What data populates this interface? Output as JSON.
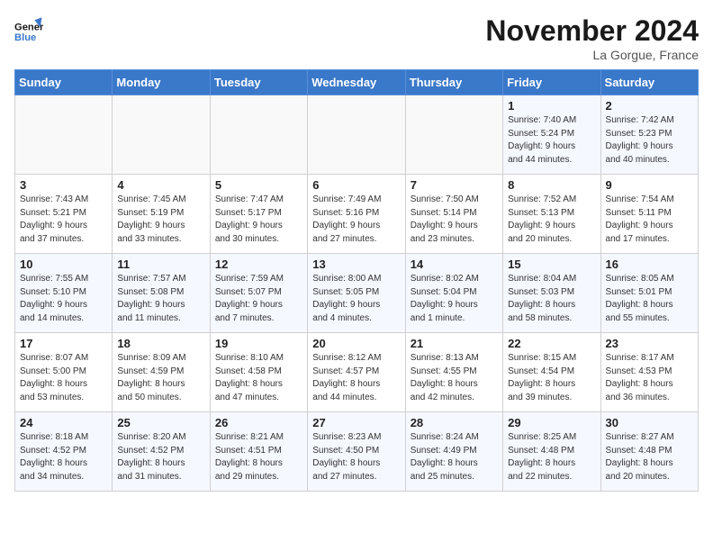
{
  "header": {
    "logo_line1": "General",
    "logo_line2": "Blue",
    "month": "November 2024",
    "location": "La Gorgue, France"
  },
  "weekdays": [
    "Sunday",
    "Monday",
    "Tuesday",
    "Wednesday",
    "Thursday",
    "Friday",
    "Saturday"
  ],
  "weeks": [
    [
      {
        "day": "",
        "info": ""
      },
      {
        "day": "",
        "info": ""
      },
      {
        "day": "",
        "info": ""
      },
      {
        "day": "",
        "info": ""
      },
      {
        "day": "",
        "info": ""
      },
      {
        "day": "1",
        "info": "Sunrise: 7:40 AM\nSunset: 5:24 PM\nDaylight: 9 hours\nand 44 minutes."
      },
      {
        "day": "2",
        "info": "Sunrise: 7:42 AM\nSunset: 5:23 PM\nDaylight: 9 hours\nand 40 minutes."
      }
    ],
    [
      {
        "day": "3",
        "info": "Sunrise: 7:43 AM\nSunset: 5:21 PM\nDaylight: 9 hours\nand 37 minutes."
      },
      {
        "day": "4",
        "info": "Sunrise: 7:45 AM\nSunset: 5:19 PM\nDaylight: 9 hours\nand 33 minutes."
      },
      {
        "day": "5",
        "info": "Sunrise: 7:47 AM\nSunset: 5:17 PM\nDaylight: 9 hours\nand 30 minutes."
      },
      {
        "day": "6",
        "info": "Sunrise: 7:49 AM\nSunset: 5:16 PM\nDaylight: 9 hours\nand 27 minutes."
      },
      {
        "day": "7",
        "info": "Sunrise: 7:50 AM\nSunset: 5:14 PM\nDaylight: 9 hours\nand 23 minutes."
      },
      {
        "day": "8",
        "info": "Sunrise: 7:52 AM\nSunset: 5:13 PM\nDaylight: 9 hours\nand 20 minutes."
      },
      {
        "day": "9",
        "info": "Sunrise: 7:54 AM\nSunset: 5:11 PM\nDaylight: 9 hours\nand 17 minutes."
      }
    ],
    [
      {
        "day": "10",
        "info": "Sunrise: 7:55 AM\nSunset: 5:10 PM\nDaylight: 9 hours\nand 14 minutes."
      },
      {
        "day": "11",
        "info": "Sunrise: 7:57 AM\nSunset: 5:08 PM\nDaylight: 9 hours\nand 11 minutes."
      },
      {
        "day": "12",
        "info": "Sunrise: 7:59 AM\nSunset: 5:07 PM\nDaylight: 9 hours\nand 7 minutes."
      },
      {
        "day": "13",
        "info": "Sunrise: 8:00 AM\nSunset: 5:05 PM\nDaylight: 9 hours\nand 4 minutes."
      },
      {
        "day": "14",
        "info": "Sunrise: 8:02 AM\nSunset: 5:04 PM\nDaylight: 9 hours\nand 1 minute."
      },
      {
        "day": "15",
        "info": "Sunrise: 8:04 AM\nSunset: 5:03 PM\nDaylight: 8 hours\nand 58 minutes."
      },
      {
        "day": "16",
        "info": "Sunrise: 8:05 AM\nSunset: 5:01 PM\nDaylight: 8 hours\nand 55 minutes."
      }
    ],
    [
      {
        "day": "17",
        "info": "Sunrise: 8:07 AM\nSunset: 5:00 PM\nDaylight: 8 hours\nand 53 minutes."
      },
      {
        "day": "18",
        "info": "Sunrise: 8:09 AM\nSunset: 4:59 PM\nDaylight: 8 hours\nand 50 minutes."
      },
      {
        "day": "19",
        "info": "Sunrise: 8:10 AM\nSunset: 4:58 PM\nDaylight: 8 hours\nand 47 minutes."
      },
      {
        "day": "20",
        "info": "Sunrise: 8:12 AM\nSunset: 4:57 PM\nDaylight: 8 hours\nand 44 minutes."
      },
      {
        "day": "21",
        "info": "Sunrise: 8:13 AM\nSunset: 4:55 PM\nDaylight: 8 hours\nand 42 minutes."
      },
      {
        "day": "22",
        "info": "Sunrise: 8:15 AM\nSunset: 4:54 PM\nDaylight: 8 hours\nand 39 minutes."
      },
      {
        "day": "23",
        "info": "Sunrise: 8:17 AM\nSunset: 4:53 PM\nDaylight: 8 hours\nand 36 minutes."
      }
    ],
    [
      {
        "day": "24",
        "info": "Sunrise: 8:18 AM\nSunset: 4:52 PM\nDaylight: 8 hours\nand 34 minutes."
      },
      {
        "day": "25",
        "info": "Sunrise: 8:20 AM\nSunset: 4:52 PM\nDaylight: 8 hours\nand 31 minutes."
      },
      {
        "day": "26",
        "info": "Sunrise: 8:21 AM\nSunset: 4:51 PM\nDaylight: 8 hours\nand 29 minutes."
      },
      {
        "day": "27",
        "info": "Sunrise: 8:23 AM\nSunset: 4:50 PM\nDaylight: 8 hours\nand 27 minutes."
      },
      {
        "day": "28",
        "info": "Sunrise: 8:24 AM\nSunset: 4:49 PM\nDaylight: 8 hours\nand 25 minutes."
      },
      {
        "day": "29",
        "info": "Sunrise: 8:25 AM\nSunset: 4:48 PM\nDaylight: 8 hours\nand 22 minutes."
      },
      {
        "day": "30",
        "info": "Sunrise: 8:27 AM\nSunset: 4:48 PM\nDaylight: 8 hours\nand 20 minutes."
      }
    ]
  ]
}
